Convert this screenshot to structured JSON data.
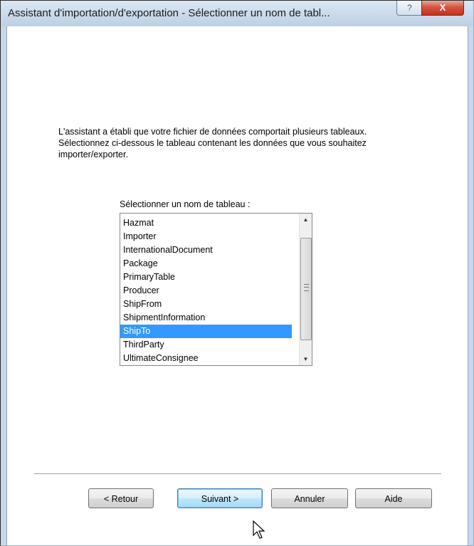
{
  "window": {
    "title": "Assistant d'importation/d'exportation - Sélectionner un nom de tabl...",
    "help_glyph": "?",
    "close_glyph": "X"
  },
  "intro_text": "L'assistant a établi que votre fichier de données comportait plusieurs tableaux. Sélectionnez ci-dessous le tableau contenant les données que vous souhaitez importer/exporter.",
  "table_list": {
    "label": "Sélectionner un nom de tableau :",
    "items": [
      "Hazmat",
      "Importer",
      "InternationalDocument",
      "Package",
      "PrimaryTable",
      "Producer",
      "ShipFrom",
      "ShipmentInformation",
      "ShipTo",
      "ThirdParty",
      "UltimateConsignee"
    ],
    "selected": "ShipTo",
    "scroll_up_glyph": "▲",
    "scroll_down_glyph": "▼"
  },
  "buttons": {
    "back": "< Retour",
    "next": "Suivant >",
    "cancel": "Annuler",
    "help": "Aide"
  },
  "colors": {
    "selection": "#3399ff",
    "close_button": "#c2321c",
    "titlebar": "#cddcec"
  }
}
